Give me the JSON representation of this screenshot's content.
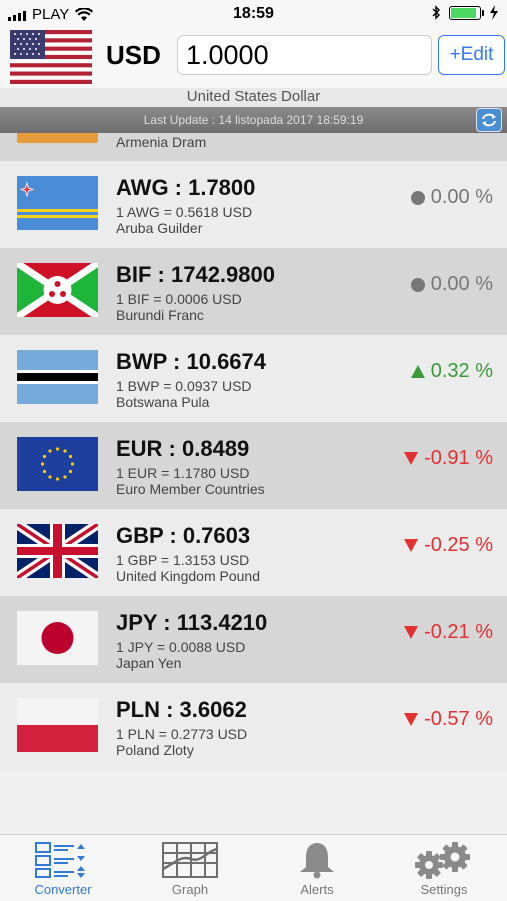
{
  "statusbar": {
    "carrier": "PLAY",
    "time": "18:59"
  },
  "header": {
    "code": "USD",
    "amount": "1.0000",
    "edit_label": "+Edit",
    "currency_name": "United States Dollar"
  },
  "update": {
    "text": "Last Update : 14 listopada 2017 18:59:19"
  },
  "partial_row": {
    "name": "Armenia Dram"
  },
  "rows": [
    {
      "title": "AWG : 1.7800",
      "rate": "1 AWG = 0.5618 USD",
      "name": "Aruba Guilder",
      "change": "0.00 %",
      "trend": "neutral"
    },
    {
      "title": "BIF : 1742.9800",
      "rate": "1 BIF = 0.0006 USD",
      "name": "Burundi Franc",
      "change": "0.00 %",
      "trend": "neutral"
    },
    {
      "title": "BWP : 10.6674",
      "rate": "1 BWP = 0.0937 USD",
      "name": "Botswana Pula",
      "change": "0.32 %",
      "trend": "up"
    },
    {
      "title": "EUR : 0.8489",
      "rate": "1 EUR = 1.1780 USD",
      "name": "Euro Member Countries",
      "change": "-0.91 %",
      "trend": "down"
    },
    {
      "title": "GBP : 0.7603",
      "rate": "1 GBP = 1.3153 USD",
      "name": "United Kingdom Pound",
      "change": "-0.25 %",
      "trend": "down"
    },
    {
      "title": "JPY : 113.4210",
      "rate": "1 JPY = 0.0088 USD",
      "name": "Japan Yen",
      "change": "-0.21 %",
      "trend": "down"
    },
    {
      "title": "PLN : 3.6062",
      "rate": "1 PLN = 0.2773 USD",
      "name": "Poland Zloty",
      "change": "-0.57 %",
      "trend": "down"
    }
  ],
  "tabs": [
    {
      "label": "Converter",
      "icon": "converter-icon",
      "active": true
    },
    {
      "label": "Graph",
      "icon": "graph-icon",
      "active": false
    },
    {
      "label": "Alerts",
      "icon": "bell-icon",
      "active": false
    },
    {
      "label": "Settings",
      "icon": "gear-icon",
      "active": false
    }
  ],
  "colors": {
    "accent": "#3478f6",
    "up": "#3a9a3a",
    "down": "#e53030",
    "neutral": "#777777"
  }
}
